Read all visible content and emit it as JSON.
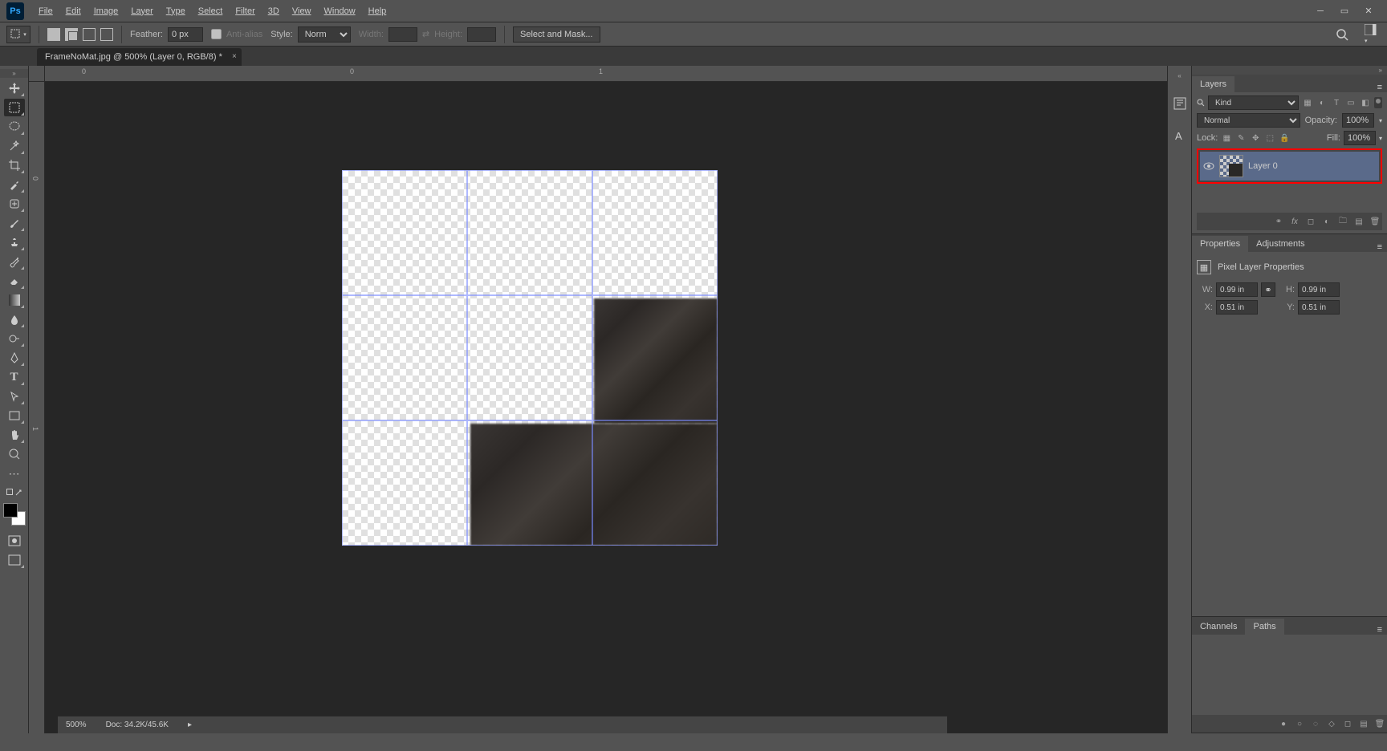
{
  "menubar": {
    "items": [
      "File",
      "Edit",
      "Image",
      "Layer",
      "Type",
      "Select",
      "Filter",
      "3D",
      "View",
      "Window",
      "Help"
    ]
  },
  "optionsbar": {
    "feather_label": "Feather:",
    "feather_value": "0 px",
    "antialias_label": "Anti-alias",
    "style_label": "Style:",
    "style_value": "Normal",
    "width_label": "Width:",
    "height_label": "Height:",
    "select_mask": "Select and Mask..."
  },
  "doctab": {
    "title": "FrameNoMat.jpg @ 500% (Layer 0, RGB/8) *"
  },
  "ruler": {
    "h0": "0",
    "h1": "1",
    "v0": "0",
    "v1": "1"
  },
  "panels": {
    "layers": {
      "tab": "Layers",
      "filter_kind": "Kind",
      "blend_mode": "Normal",
      "opacity_label": "Opacity:",
      "opacity_value": "100%",
      "lock_label": "Lock:",
      "fill_label": "Fill:",
      "fill_value": "100%",
      "layer_name": "Layer 0"
    },
    "properties": {
      "tab_properties": "Properties",
      "tab_adjustments": "Adjustments",
      "pixel_label": "Pixel Layer Properties",
      "w_label": "W:",
      "w_value": "0.99 in",
      "h_label": "H:",
      "h_value": "0.99 in",
      "x_label": "X:",
      "x_value": "0.51 in",
      "y_label": "Y:",
      "y_value": "0.51 in"
    },
    "channels": {
      "tab_channels": "Channels",
      "tab_paths": "Paths"
    }
  },
  "statusbar": {
    "zoom": "500%",
    "doc_label": "Doc:",
    "doc_size": "34.2K/45.6K"
  }
}
